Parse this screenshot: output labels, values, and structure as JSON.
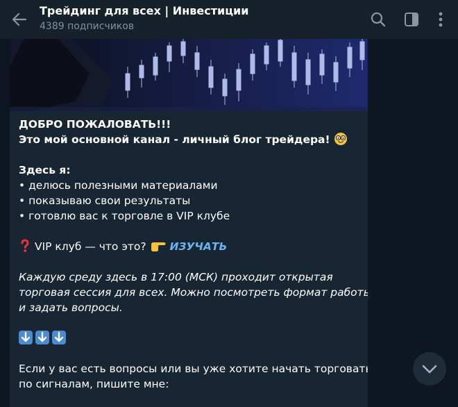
{
  "header": {
    "title": "Трейдинг для всех | Инвестиции",
    "subscribers": "4389 подписчиков"
  },
  "message": {
    "line1": "ДОБРО ПОЖАЛОВАТЬ!!!",
    "line2": "Это мой основной канал - личный блог трейдера!",
    "here_label": "Здесь я:",
    "bullets": [
      "• делюсь полезными материалами",
      "• показываю свои результаты",
      "• готовлю вас к торговле в VIP клубе"
    ],
    "vip_question": "VIP клуб — что это?",
    "vip_link": "ИЗУЧАТЬ",
    "italic_lines": [
      "Каждую среду здесь в 17:00 (МСК) проходит открытая",
      "торговая сессия для всех. Можно посмотреть формат работы",
      "и задать вопросы."
    ],
    "contact_lines": [
      "Если у вас есть вопросы или вы уже хотите начать торговать",
      "по сигналам, пишите мне:"
    ]
  },
  "colors": {
    "header_bg": "#17212b",
    "chat_bg": "#0e1621",
    "bubble_bg": "#182533",
    "link": "#6ab2f2",
    "subtitle": "#7f91a4"
  },
  "icons": [
    "back-arrow-icon",
    "search-icon",
    "sidebar-toggle-icon",
    "more-vertical-icon",
    "nerd-face-icon",
    "question-mark-icon",
    "pointing-hand-icon",
    "down-arrow-icon",
    "chevron-down-icon"
  ]
}
